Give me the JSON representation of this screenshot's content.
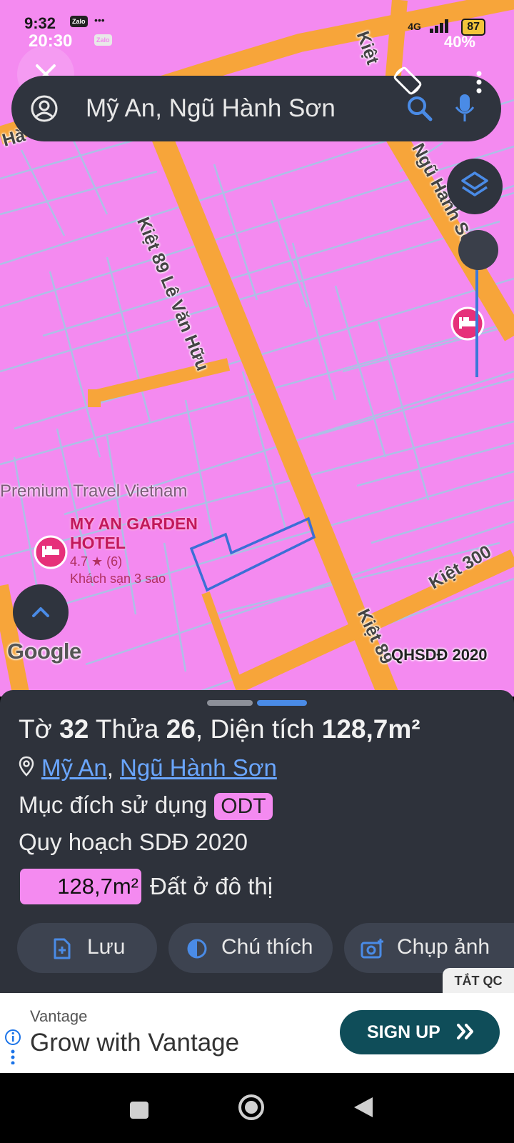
{
  "status_bar": {
    "time": "9:32",
    "time_overlay": "20:30",
    "zalo_a": "Zalo",
    "zalo_b": "Zalo",
    "dots": "•••",
    "network": "4G",
    "battery": "87",
    "battery_overlay": "40%"
  },
  "search": {
    "query": "Mỹ An, Ngũ Hành Sơn"
  },
  "map": {
    "road_labels": {
      "kiet89_le_van_huu": "Kiệt 89 Lê Văn Hữu",
      "ngu_hanh_son": "Ngũ Hành Sơ",
      "kiet300": "Kiệt 300",
      "kiet89_bottom": "Kiệt 89",
      "kiet_top": "Kiệt",
      "left_edge": "Hà"
    },
    "poi_premium": "Premium Travel Vietnam",
    "hotel": {
      "name_line1": "MY AN GARDEN",
      "name_line2": "HOTEL",
      "rating": "4.7 ★ (6)",
      "category": "Khách sạn 3 sao"
    },
    "google_logo": "Google",
    "plan_label": "QHSDĐ 2020",
    "colors": {
      "land_residential": "#f48af0",
      "road": "#f7a53a",
      "parcel_line": "#9fb8d8",
      "selected_parcel": "#3b6fd6"
    }
  },
  "sheet": {
    "title_prefix": "Tờ ",
    "sheet_no": "32",
    "title_mid1": " Thửa ",
    "parcel_no": "26",
    "title_mid2": ", Diện tích ",
    "area": "128,7m²",
    "location_ward": "Mỹ An",
    "location_sep": ", ",
    "location_district": "Ngũ Hành Sơn",
    "purpose_label": "Mục đích sử dụng",
    "purpose_code": "ODT",
    "plan_label": "Quy hoạch SDĐ 2020",
    "plan_area": "128,7m²",
    "plan_desc": "Đất ở đô thị",
    "actions": {
      "save": "Lưu",
      "legend": "Chú thích",
      "screenshot": "Chụp ảnh"
    }
  },
  "ad": {
    "close_label": "TẮT QC",
    "brand": "Vantage",
    "headline": "Grow with Vantage",
    "cta": "SIGN UP"
  }
}
